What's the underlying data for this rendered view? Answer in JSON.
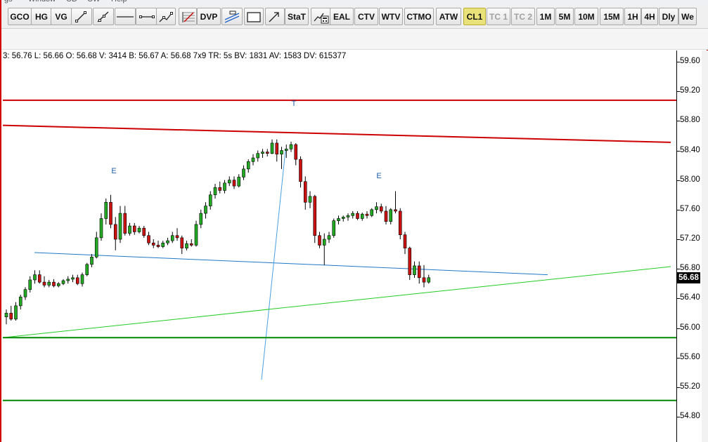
{
  "menubar": {
    "items": [
      "gs",
      "Window",
      "CD",
      "CW",
      "Help"
    ]
  },
  "toolbar": {
    "buttons": [
      {
        "key": "gco",
        "label": "GCO"
      },
      {
        "key": "hg",
        "label": "HG"
      },
      {
        "key": "vg",
        "label": "VG"
      },
      {
        "key": "dvp",
        "label": "DVP"
      },
      {
        "key": "stat",
        "label": "StaT"
      },
      {
        "key": "eal",
        "label": "EAL"
      },
      {
        "key": "ctv",
        "label": "CTV"
      },
      {
        "key": "wtv",
        "label": "WTV"
      },
      {
        "key": "ctmo",
        "label": "CTMO"
      },
      {
        "key": "atw",
        "label": "ATW"
      },
      {
        "key": "cl1",
        "label": "CL1"
      },
      {
        "key": "tc1",
        "label": "TC 1"
      },
      {
        "key": "tc2",
        "label": "TC 2"
      },
      {
        "key": "m1",
        "label": "1M"
      },
      {
        "key": "m5",
        "label": "5M"
      },
      {
        "key": "m10",
        "label": "10M"
      },
      {
        "key": "m15",
        "label": "15M"
      },
      {
        "key": "h1",
        "label": "1H"
      },
      {
        "key": "h4",
        "label": "4H"
      },
      {
        "key": "dly",
        "label": "Dly"
      },
      {
        "key": "we",
        "label": "We"
      }
    ],
    "icons": [
      "line-tool-icon",
      "ray-tool-icon",
      "horizontal-line-icon",
      "horizontal-segment-icon",
      "trend-channel-icon",
      "fibonacci-icon",
      "parallel-lines-icon",
      "rectangle-icon",
      "arrow-tool-icon",
      "calculator-chart-icon"
    ]
  },
  "status_line": "3: 56.76  L: 56.66  O: 56.68  V: 3414  B: 56.67  A: 56.68  7x9  TR: 5s  BV: 1831  AV: 1583  DV: 615377",
  "chart_data": {
    "type": "candlestick",
    "instrument": "CL1",
    "price_axis": {
      "ticks": [
        "59.60",
        "59.20",
        "58.80",
        "58.40",
        "58.00",
        "57.60",
        "57.20",
        "56.80",
        "56.40",
        "56.00",
        "55.60",
        "55.20",
        "54.80"
      ],
      "range": [
        54.6,
        59.75
      ]
    },
    "last_price": "56.68",
    "annotations": [
      "E",
      "T",
      "E"
    ],
    "candles": [
      [
        56.15,
        56.25,
        56.05,
        56.2
      ],
      [
        56.2,
        56.3,
        56.1,
        56.12
      ],
      [
        56.12,
        56.35,
        56.1,
        56.3
      ],
      [
        56.3,
        56.45,
        56.25,
        56.42
      ],
      [
        56.42,
        56.55,
        56.38,
        56.52
      ],
      [
        56.52,
        56.7,
        56.48,
        56.65
      ],
      [
        56.65,
        56.78,
        56.6,
        56.72
      ],
      [
        56.72,
        56.78,
        56.6,
        56.62
      ],
      [
        56.62,
        56.7,
        56.55,
        56.58
      ],
      [
        56.58,
        56.65,
        56.55,
        56.62
      ],
      [
        56.62,
        56.66,
        56.55,
        56.57
      ],
      [
        56.57,
        56.62,
        56.55,
        56.6
      ],
      [
        56.6,
        56.66,
        56.58,
        56.64
      ],
      [
        56.64,
        56.7,
        56.6,
        56.66
      ],
      [
        56.66,
        56.72,
        56.62,
        56.68
      ],
      [
        56.68,
        56.72,
        56.58,
        56.6
      ],
      [
        56.6,
        56.75,
        56.56,
        56.72
      ],
      [
        56.72,
        56.88,
        56.7,
        56.86
      ],
      [
        56.86,
        57.0,
        56.82,
        56.96
      ],
      [
        56.96,
        57.3,
        56.94,
        57.22
      ],
      [
        57.22,
        57.55,
        57.18,
        57.48
      ],
      [
        57.48,
        57.75,
        57.4,
        57.7
      ],
      [
        57.7,
        57.8,
        57.35,
        57.4
      ],
      [
        57.4,
        57.5,
        57.05,
        57.2
      ],
      [
        57.2,
        57.65,
        57.15,
        57.55
      ],
      [
        57.55,
        57.65,
        57.25,
        57.28
      ],
      [
        57.28,
        57.42,
        57.25,
        57.38
      ],
      [
        57.38,
        57.42,
        57.26,
        57.3
      ],
      [
        57.3,
        57.38,
        57.28,
        57.35
      ],
      [
        57.35,
        57.38,
        57.22,
        57.25
      ],
      [
        57.25,
        57.3,
        57.12,
        57.15
      ],
      [
        57.15,
        57.2,
        57.08,
        57.12
      ],
      [
        57.12,
        57.18,
        57.08,
        57.1
      ],
      [
        57.1,
        57.18,
        57.08,
        57.15
      ],
      [
        57.15,
        57.22,
        57.12,
        57.18
      ],
      [
        57.18,
        57.3,
        57.15,
        57.25
      ],
      [
        57.25,
        57.35,
        57.18,
        57.22
      ],
      [
        57.22,
        57.25,
        57.0,
        57.08
      ],
      [
        57.08,
        57.18,
        57.05,
        57.14
      ],
      [
        57.14,
        57.2,
        57.1,
        57.12
      ],
      [
        57.12,
        57.45,
        57.1,
        57.4
      ],
      [
        57.4,
        57.6,
        57.35,
        57.55
      ],
      [
        57.55,
        57.7,
        57.48,
        57.65
      ],
      [
        57.65,
        57.85,
        57.6,
        57.8
      ],
      [
        57.8,
        57.95,
        57.75,
        57.9
      ],
      [
        57.9,
        57.98,
        57.82,
        57.86
      ],
      [
        57.86,
        58.0,
        57.82,
        57.96
      ],
      [
        57.96,
        58.05,
        57.92,
        58.0
      ],
      [
        58.0,
        58.05,
        57.88,
        57.92
      ],
      [
        57.92,
        58.08,
        57.9,
        58.04
      ],
      [
        58.04,
        58.2,
        58.0,
        58.15
      ],
      [
        58.15,
        58.28,
        58.1,
        58.25
      ],
      [
        58.25,
        58.35,
        58.2,
        58.3
      ],
      [
        58.3,
        58.4,
        58.25,
        58.36
      ],
      [
        58.36,
        58.42,
        58.3,
        58.38
      ],
      [
        58.38,
        58.42,
        58.32,
        58.36
      ],
      [
        58.36,
        58.55,
        58.35,
        58.5
      ],
      [
        58.5,
        58.55,
        58.25,
        58.35
      ],
      [
        58.35,
        58.45,
        58.15,
        58.4
      ],
      [
        58.4,
        58.48,
        58.3,
        58.42
      ],
      [
        58.42,
        58.52,
        58.38,
        58.48
      ],
      [
        58.48,
        58.5,
        58.2,
        58.28
      ],
      [
        58.28,
        58.32,
        57.9,
        57.98
      ],
      [
        57.98,
        58.05,
        57.6,
        57.7
      ],
      [
        57.7,
        57.85,
        57.62,
        57.78
      ],
      [
        57.78,
        57.8,
        57.15,
        57.25
      ],
      [
        57.25,
        57.3,
        57.08,
        57.12
      ],
      [
        57.12,
        57.28,
        56.85,
        57.2
      ],
      [
        57.2,
        57.3,
        57.15,
        57.25
      ],
      [
        57.25,
        57.48,
        57.22,
        57.45
      ],
      [
        57.45,
        57.52,
        57.4,
        57.48
      ],
      [
        57.48,
        57.52,
        57.44,
        57.5
      ],
      [
        57.5,
        57.55,
        57.45,
        57.52
      ],
      [
        57.52,
        57.58,
        57.48,
        57.55
      ],
      [
        57.55,
        57.58,
        57.46,
        57.48
      ],
      [
        57.48,
        57.56,
        57.45,
        57.54
      ],
      [
        57.54,
        57.58,
        57.48,
        57.52
      ],
      [
        57.52,
        57.62,
        57.5,
        57.6
      ],
      [
        57.6,
        57.7,
        57.55,
        57.64
      ],
      [
        57.64,
        57.68,
        57.55,
        57.58
      ],
      [
        57.58,
        57.65,
        57.4,
        57.44
      ],
      [
        57.44,
        57.62,
        57.4,
        57.6
      ],
      [
        57.6,
        57.85,
        57.55,
        57.58
      ],
      [
        57.58,
        57.62,
        57.2,
        57.26
      ],
      [
        57.26,
        57.3,
        57.0,
        57.08
      ],
      [
        57.08,
        57.1,
        56.65,
        56.72
      ],
      [
        56.72,
        56.9,
        56.68,
        56.84
      ],
      [
        56.84,
        56.9,
        56.6,
        56.68
      ],
      [
        56.68,
        56.85,
        56.55,
        56.62
      ],
      [
        56.62,
        56.72,
        56.6,
        56.68
      ]
    ],
    "trendlines": [
      {
        "name": "resistance-top",
        "color": "#cc0000",
        "points": [
          [
            0,
            59.08
          ],
          [
            958,
            59.08
          ]
        ]
      },
      {
        "name": "descending-red",
        "color": "#cc0000",
        "points": [
          [
            0,
            58.74
          ],
          [
            950,
            58.51
          ]
        ]
      },
      {
        "name": "blue-neckline",
        "color": "#1f78c8",
        "points": [
          [
            45,
            57.02
          ],
          [
            775,
            56.72
          ]
        ]
      },
      {
        "name": "blue-steep",
        "color": "#4aa0e0",
        "points": [
          [
            368,
            55.3
          ],
          [
            402,
            58.4
          ]
        ]
      },
      {
        "name": "green-rising",
        "color": "#22cc22",
        "points": [
          [
            0,
            55.87
          ],
          [
            950,
            56.83
          ]
        ]
      },
      {
        "name": "support-green-1",
        "color": "#008800",
        "points": [
          [
            0,
            55.87
          ],
          [
            958,
            55.87
          ]
        ]
      },
      {
        "name": "support-green-2",
        "color": "#008800",
        "points": [
          [
            0,
            55.02
          ],
          [
            958,
            55.02
          ]
        ]
      }
    ],
    "colors": {
      "up": "#22aa22",
      "down": "#cc1111",
      "wick": "#000000"
    }
  }
}
